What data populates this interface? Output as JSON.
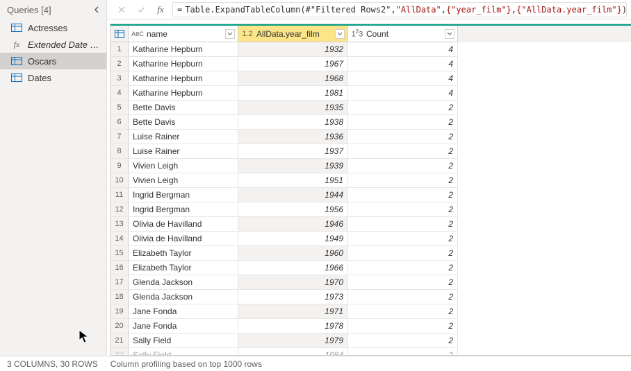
{
  "sidebar": {
    "title": "Queries [4]",
    "items": [
      {
        "label": "Actresses",
        "type": "table",
        "italic": false,
        "selected": false
      },
      {
        "label": "Extended Date Table",
        "type": "fx",
        "italic": true,
        "selected": false
      },
      {
        "label": "Oscars",
        "type": "table",
        "italic": false,
        "selected": true
      },
      {
        "label": "Dates",
        "type": "table",
        "italic": false,
        "selected": false
      }
    ]
  },
  "formula": {
    "fn": "Table.ExpandTableColumn",
    "ref": "#\"Filtered Rows2\"",
    "arg1": "\"AllData\"",
    "arg2": "{\"year_film\"}",
    "arg3": "{\"AllData.year_film\"}"
  },
  "columns": [
    {
      "typeLabel": "ABC",
      "label": "name",
      "selected": false,
      "class": "c-name"
    },
    {
      "typeLabel": "1.2",
      "label": "AllData.year_film",
      "selected": true,
      "class": "c-year"
    },
    {
      "typeLabel": "1²3",
      "label": "Count",
      "selected": false,
      "class": "c-count"
    }
  ],
  "rows": [
    {
      "n": 1,
      "name": "Katharine Hepburn",
      "year": "1932",
      "count": "4"
    },
    {
      "n": 2,
      "name": "Katharine Hepburn",
      "year": "1967",
      "count": "4"
    },
    {
      "n": 3,
      "name": "Katharine Hepburn",
      "year": "1968",
      "count": "4"
    },
    {
      "n": 4,
      "name": "Katharine Hepburn",
      "year": "1981",
      "count": "4"
    },
    {
      "n": 5,
      "name": "Bette Davis",
      "year": "1935",
      "count": "2"
    },
    {
      "n": 6,
      "name": "Bette Davis",
      "year": "1938",
      "count": "2"
    },
    {
      "n": 7,
      "name": "Luise Rainer",
      "year": "1936",
      "count": "2"
    },
    {
      "n": 8,
      "name": "Luise Rainer",
      "year": "1937",
      "count": "2"
    },
    {
      "n": 9,
      "name": "Vivien Leigh",
      "year": "1939",
      "count": "2"
    },
    {
      "n": 10,
      "name": "Vivien Leigh",
      "year": "1951",
      "count": "2"
    },
    {
      "n": 11,
      "name": "Ingrid Bergman",
      "year": "1944",
      "count": "2"
    },
    {
      "n": 12,
      "name": "Ingrid Bergman",
      "year": "1956",
      "count": "2"
    },
    {
      "n": 13,
      "name": "Olivia de Havilland",
      "year": "1946",
      "count": "2"
    },
    {
      "n": 14,
      "name": "Olivia de Havilland",
      "year": "1949",
      "count": "2"
    },
    {
      "n": 15,
      "name": "Elizabeth Taylor",
      "year": "1960",
      "count": "2"
    },
    {
      "n": 16,
      "name": "Elizabeth Taylor",
      "year": "1966",
      "count": "2"
    },
    {
      "n": 17,
      "name": "Glenda Jackson",
      "year": "1970",
      "count": "2"
    },
    {
      "n": 18,
      "name": "Glenda Jackson",
      "year": "1973",
      "count": "2"
    },
    {
      "n": 19,
      "name": "Jane Fonda",
      "year": "1971",
      "count": "2"
    },
    {
      "n": 20,
      "name": "Jane Fonda",
      "year": "1978",
      "count": "2"
    },
    {
      "n": 21,
      "name": "Sally Field",
      "year": "1979",
      "count": "2"
    },
    {
      "n": 22,
      "name": "Sally Field",
      "year": "1984",
      "count": "2",
      "cut": true
    }
  ],
  "status": {
    "columns_rows": "3 COLUMNS, 30 ROWS",
    "profiling": "Column profiling based on top 1000 rows"
  }
}
